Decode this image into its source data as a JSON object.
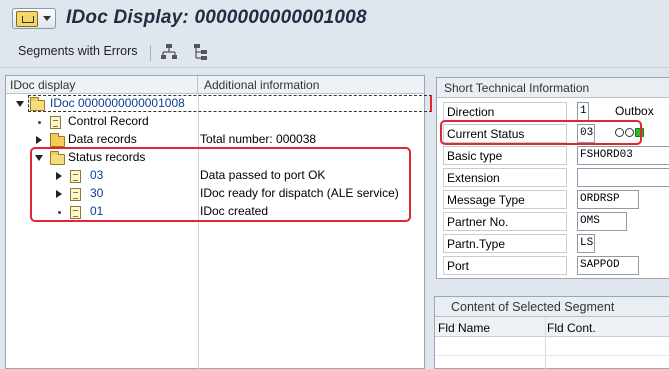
{
  "window": {
    "title": "IDoc Display: 0000000000001008"
  },
  "toolbar": {
    "segments_with_errors": "Segments with Errors"
  },
  "tree": {
    "header_col1": "IDoc display",
    "header_col2": "Additional information",
    "root_label": "IDoc 0000000000001008",
    "control_record": "Control Record",
    "data_records": "Data records",
    "data_records_info": "Total number: 000038",
    "status_records": "Status records",
    "statuses": [
      {
        "code": "03",
        "info": "Data passed to port OK"
      },
      {
        "code": "30",
        "info": "IDoc ready for dispatch (ALE service)"
      },
      {
        "code": "01",
        "info": "IDoc created"
      }
    ]
  },
  "sti": {
    "title": "Short Technical Information",
    "rows": [
      {
        "label": "Direction",
        "value": "1",
        "extra": "Outbox"
      },
      {
        "label": "Current Status",
        "value": "03"
      },
      {
        "label": "Basic type",
        "value": "FSHORD03"
      },
      {
        "label": "Extension",
        "value": ""
      },
      {
        "label": "Message Type",
        "value": "ORDRSP"
      },
      {
        "label": "Partner No.",
        "value": "OMS"
      },
      {
        "label": "Partn.Type",
        "value": "LS"
      },
      {
        "label": "Port",
        "value": "SAPPOD"
      }
    ],
    "status_light_color": "#1fc21f"
  },
  "segment": {
    "title": "Content of Selected Segment",
    "col1": "Fld Name",
    "col2": "Fld Cont."
  }
}
